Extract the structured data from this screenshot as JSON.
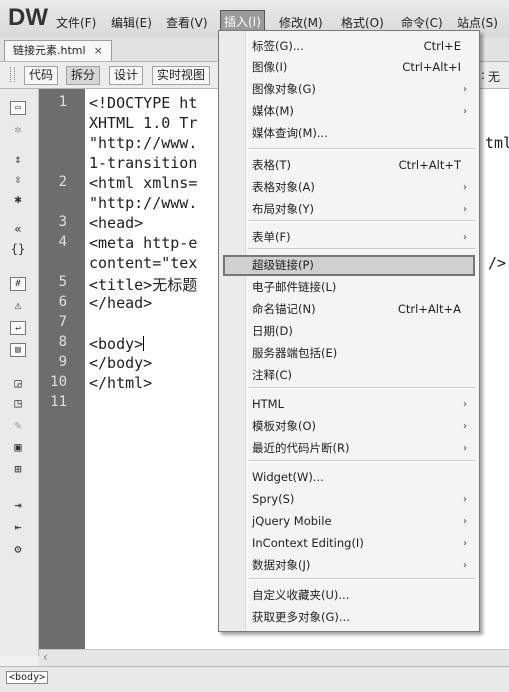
{
  "app": {
    "logo": "DW"
  },
  "menubar": {
    "items": [
      "文件(F)",
      "编辑(E)",
      "查看(V)",
      "插入(I)",
      "修改(M)",
      "格式(O)",
      "命令(C)",
      "站点(S)"
    ]
  },
  "document_tab": {
    "label": "链接元素.html",
    "close": "×"
  },
  "viewbar": {
    "buttons": [
      "代码",
      "拆分",
      "设计",
      "实时视图"
    ],
    "title_fragment": "无",
    "title_colon": ":"
  },
  "code": {
    "line_numbers": [
      "1",
      "2",
      "3",
      "4",
      "5",
      "6",
      "7",
      "8",
      "9",
      "10",
      "11"
    ],
    "lines": [
      "<!DOCTYPE ht",
      "XHTML 1.0 Tr",
      "\"http://www.",
      "1-transition",
      "<html xmlns=",
      "\"http://www.",
      "<head>",
      "<meta http-e",
      "content=\"tex",
      "<title>无标题",
      "</head>",
      "",
      "<body>",
      "</body>",
      "</html>"
    ],
    "right_fragments": [
      "tml",
      "/>"
    ]
  },
  "statusbar": {
    "tag": "<body>"
  },
  "insert_menu": {
    "items": [
      {
        "label": "标签(G)...",
        "shortcut": "Ctrl+E",
        "submenu": false
      },
      {
        "label": "图像(I)",
        "shortcut": "Ctrl+Alt+I",
        "submenu": false
      },
      {
        "label": "图像对象(G)",
        "shortcut": "",
        "submenu": true
      },
      {
        "label": "媒体(M)",
        "shortcut": "",
        "submenu": true
      },
      {
        "label": "媒体查询(M)...",
        "shortcut": "",
        "submenu": false
      },
      {
        "label": "表格(T)",
        "shortcut": "Ctrl+Alt+T",
        "submenu": false
      },
      {
        "label": "表格对象(A)",
        "shortcut": "",
        "submenu": true
      },
      {
        "label": "布局对象(Y)",
        "shortcut": "",
        "submenu": true
      },
      {
        "label": "表单(F)",
        "shortcut": "",
        "submenu": true
      },
      {
        "label": "超级链接(P)",
        "shortcut": "",
        "submenu": false,
        "highlighted": true
      },
      {
        "label": "电子邮件链接(L)",
        "shortcut": "",
        "submenu": false
      },
      {
        "label": "命名锚记(N)",
        "shortcut": "Ctrl+Alt+A",
        "submenu": false
      },
      {
        "label": "日期(D)",
        "shortcut": "",
        "submenu": false
      },
      {
        "label": "服务器端包括(E)",
        "shortcut": "",
        "submenu": false
      },
      {
        "label": "注释(C)",
        "shortcut": "",
        "submenu": false
      },
      {
        "label": "HTML",
        "shortcut": "",
        "submenu": true
      },
      {
        "label": "模板对象(O)",
        "shortcut": "",
        "submenu": true
      },
      {
        "label": "最近的代码片断(R)",
        "shortcut": "",
        "submenu": true
      },
      {
        "label": "Widget(W)...",
        "shortcut": "",
        "submenu": false
      },
      {
        "label": "Spry(S)",
        "shortcut": "",
        "submenu": true
      },
      {
        "label": "jQuery Mobile",
        "shortcut": "",
        "submenu": true
      },
      {
        "label": "InContext Editing(I)",
        "shortcut": "",
        "submenu": true
      },
      {
        "label": "数据对象(J)",
        "shortcut": "",
        "submenu": true
      },
      {
        "label": "自定义收藏夹(U)...",
        "shortcut": "",
        "submenu": false
      },
      {
        "label": "获取更多对象(G)...",
        "shortcut": "",
        "submenu": false
      }
    ],
    "arrow_glyph": "›"
  },
  "colors": {
    "menu_highlight": "#d0d0d0",
    "gutter": "#6d6d6d",
    "editor_bg": "#ffffff"
  }
}
